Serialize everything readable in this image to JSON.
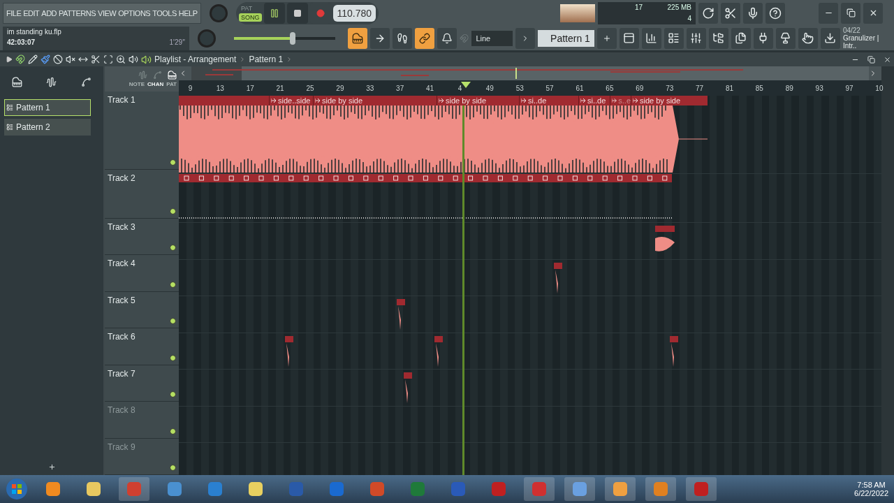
{
  "menu": [
    "FILE",
    "EDIT",
    "ADD",
    "PATTERNS",
    "VIEW",
    "OPTIONS",
    "TOOLS",
    "HELP"
  ],
  "transport": {
    "modes": [
      {
        "label": "PAT",
        "selected": false
      },
      {
        "label": "SONG",
        "selected": true
      }
    ],
    "playing": true,
    "tempo": "110.780"
  },
  "project": {
    "file_name": "im standing ku.flp",
    "time": "42:03:07",
    "duration": "1'29''"
  },
  "master_volume": {
    "level": 0.58
  },
  "performance": {
    "cpu": "17",
    "memory": "225 MB",
    "polyphony": "4"
  },
  "mode_buttons": [
    {
      "on": true
    },
    {
      "on": false
    },
    {
      "on": false
    },
    {
      "on": true
    }
  ],
  "snap": {
    "value": "Line"
  },
  "pattern_selector": {
    "value": "Pattern 1"
  },
  "hint": {
    "line_1": "04/22",
    "line_2": "Granulizer | Intr.."
  },
  "playlist": {
    "title": "Playlist - Arrangement",
    "pattern": "Pattern 1",
    "tools": [
      {
        "selected": true
      },
      {
        "selected": false
      },
      {
        "selected": true
      },
      {
        "selected": false
      },
      {
        "selected": false
      },
      {
        "selected": false
      },
      {
        "selected": false
      },
      {
        "selected": false
      },
      {
        "selected": false
      },
      {
        "selected": false
      }
    ],
    "picker_filters": [
      {
        "label": "NOTE",
        "selected": false
      },
      {
        "label": "CHAN",
        "selected": true
      },
      {
        "label": "PAT",
        "selected": false
      }
    ],
    "patterns": [
      {
        "name": "Pattern 1",
        "selected": true
      },
      {
        "name": "Pattern 2",
        "selected": false
      }
    ],
    "ruler": [
      "9",
      "13",
      "17",
      "21",
      "25",
      "29",
      "33",
      "37",
      "41",
      "4",
      "49",
      "53",
      "57",
      "61",
      "65",
      "69",
      "73",
      "77",
      "81",
      "85",
      "89",
      "93",
      "97",
      "10"
    ],
    "tracks": [
      {
        "name": "Track 1",
        "enabled": true,
        "clips": [
          {
            "name": "side..side",
            "faded": false
          },
          {
            "name": "side by side",
            "faded": false
          },
          {
            "name": "side by side",
            "faded": false
          },
          {
            "name": "si..de",
            "faded": false
          },
          {
            "name": "si..de",
            "faded": false
          },
          {
            "name": "s..e",
            "faded": true
          },
          {
            "name": "side by side",
            "faded": false
          }
        ]
      },
      {
        "name": "Track 2",
        "enabled": true
      },
      {
        "name": "Track 3",
        "enabled": true
      },
      {
        "name": "Track 4",
        "enabled": true
      },
      {
        "name": "Track 5",
        "enabled": true
      },
      {
        "name": "Track 6",
        "enabled": true
      },
      {
        "name": "Track 7",
        "enabled": true
      },
      {
        "name": "Track 8",
        "enabled": false
      },
      {
        "name": "Track 9",
        "enabled": false
      }
    ]
  },
  "taskbar": {
    "time": "7:58 AM",
    "date": "6/22/2022"
  }
}
